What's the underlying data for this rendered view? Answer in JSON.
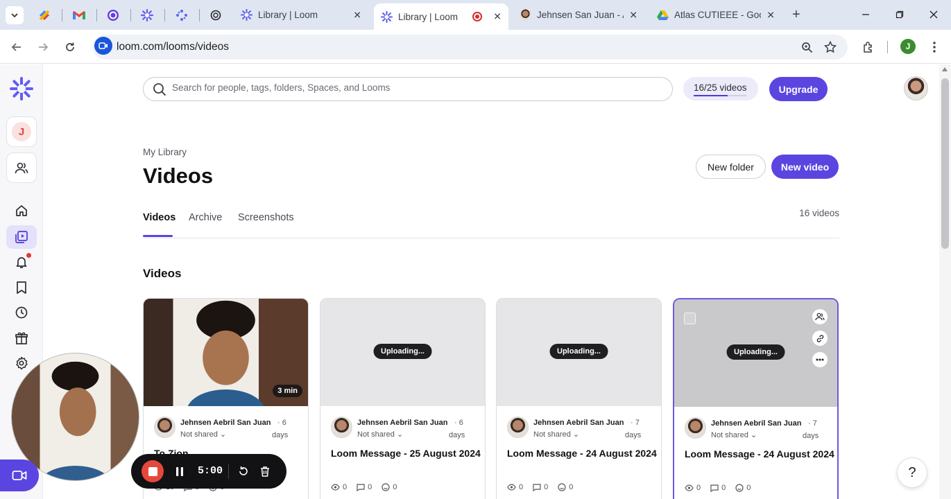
{
  "browser": {
    "tabs": [
      {
        "title": "Library | Loom",
        "active": false
      },
      {
        "title": "Library | Loom",
        "active": true
      },
      {
        "title": "Jehnsen San Juan - At",
        "active": false
      },
      {
        "title": "Atlas CUTIEEE - Goog",
        "active": false
      }
    ],
    "url": "loom.com/looms/videos",
    "profile_initial": "J"
  },
  "rail": {
    "workspace_initial": "J"
  },
  "topbar": {
    "search_placeholder": "Search for people, tags, folders, Spaces, and Looms",
    "quota_text": "16/25 videos",
    "quota_fraction": 0.64,
    "upgrade_label": "Upgrade"
  },
  "header": {
    "breadcrumb": "My Library",
    "title": "Videos",
    "new_folder_label": "New folder",
    "new_video_label": "New video"
  },
  "tabs": [
    {
      "label": "Videos",
      "active": true
    },
    {
      "label": "Archive",
      "active": false
    },
    {
      "label": "Screenshots",
      "active": false
    }
  ],
  "video_count": "16 videos",
  "section_title": "Videos",
  "cards": [
    {
      "state": "thumbnail",
      "duration": "3 min",
      "author": "Jehnsen Aebril San Juan",
      "age_num": "· 6",
      "age_unit": "days",
      "share": "Not shared",
      "title": "To Zion",
      "views": "10",
      "comments": "0",
      "reactions": "0"
    },
    {
      "state": "uploading",
      "uploading_label": "Uploading...",
      "author": "Jehnsen Aebril San Juan",
      "age_num": "· 6",
      "age_unit": "days",
      "share": "Not shared",
      "title": "Loom Message - 25 August 2024",
      "views": "0",
      "comments": "0",
      "reactions": "0"
    },
    {
      "state": "uploading",
      "uploading_label": "Uploading...",
      "author": "Jehnsen Aebril San Juan",
      "age_num": "· 7",
      "age_unit": "days",
      "share": "Not shared",
      "title": "Loom Message - 24 August 2024",
      "views": "0",
      "comments": "0",
      "reactions": "0"
    },
    {
      "state": "uploading",
      "uploading_label": "Uploading...",
      "author": "Jehnsen Aebril San Juan",
      "age_num": "· 7",
      "age_unit": "days",
      "share": "Not shared",
      "title": "Loom Message - 24 August 2024",
      "views": "0",
      "comments": "0",
      "reactions": "0",
      "selected": true
    }
  ],
  "recorder": {
    "timer": "5:00"
  },
  "help_label": "?",
  "colors": {
    "accent": "#5b45e0",
    "recording": "#e5483b",
    "tabbar": "#dfe6f1"
  },
  "icons": [
    "chevron-down-icon",
    "search-icon",
    "star-icon",
    "extensions-icon",
    "home-icon",
    "library-icon",
    "bell-icon",
    "bookmark-icon",
    "clock-icon",
    "gift-icon",
    "gear-icon",
    "people-icon",
    "link-icon",
    "more-icon",
    "eye-icon",
    "comment-icon",
    "smile-icon",
    "pause-icon",
    "restart-icon",
    "trash-icon",
    "camera-icon"
  ]
}
